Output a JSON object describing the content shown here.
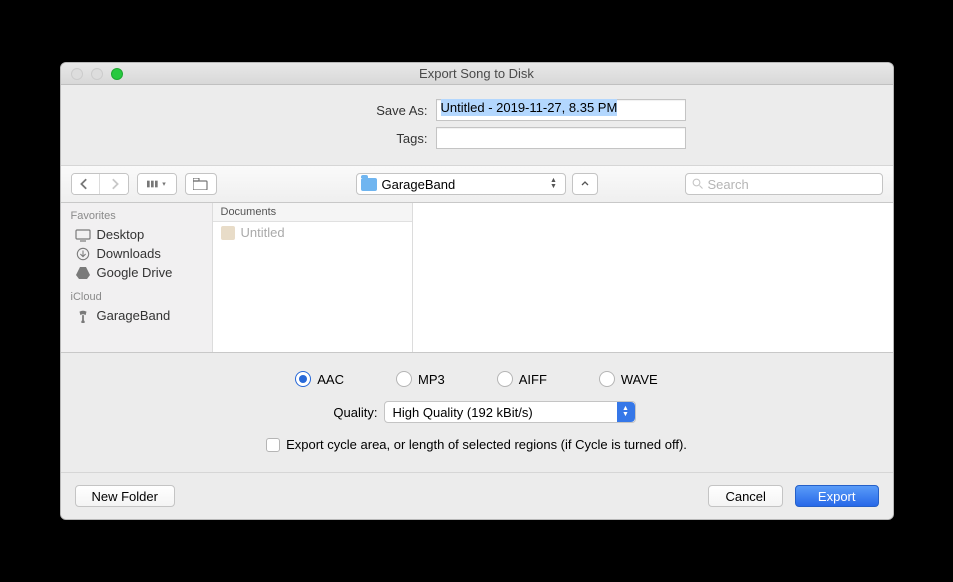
{
  "window": {
    "title": "Export Song to Disk"
  },
  "form": {
    "saveAsLabel": "Save As:",
    "saveAsValue": "Untitled - 2019-11-27, 8.35 PM",
    "tagsLabel": "Tags:",
    "tagsValue": ""
  },
  "toolbar": {
    "pathFolder": "GarageBand",
    "searchPlaceholder": "Search"
  },
  "sidebar": {
    "favoritesHeader": "Favorites",
    "favorites": [
      {
        "label": "Desktop",
        "icon": "desktop"
      },
      {
        "label": "Downloads",
        "icon": "downloads"
      },
      {
        "label": "Google Drive",
        "icon": "gdrive"
      }
    ],
    "icloudHeader": "iCloud",
    "icloud": [
      {
        "label": "GarageBand",
        "icon": "garageband"
      }
    ]
  },
  "column": {
    "header": "Documents",
    "items": [
      {
        "label": "Untitled"
      }
    ]
  },
  "formats": [
    {
      "label": "AAC",
      "selected": true
    },
    {
      "label": "MP3",
      "selected": false
    },
    {
      "label": "AIFF",
      "selected": false
    },
    {
      "label": "WAVE",
      "selected": false
    }
  ],
  "quality": {
    "label": "Quality:",
    "value": "High Quality (192 kBit/s)"
  },
  "exportCycle": {
    "label": "Export cycle area, or length of selected regions (if Cycle is turned off).",
    "checked": false
  },
  "footer": {
    "newFolder": "New Folder",
    "cancel": "Cancel",
    "export": "Export"
  }
}
